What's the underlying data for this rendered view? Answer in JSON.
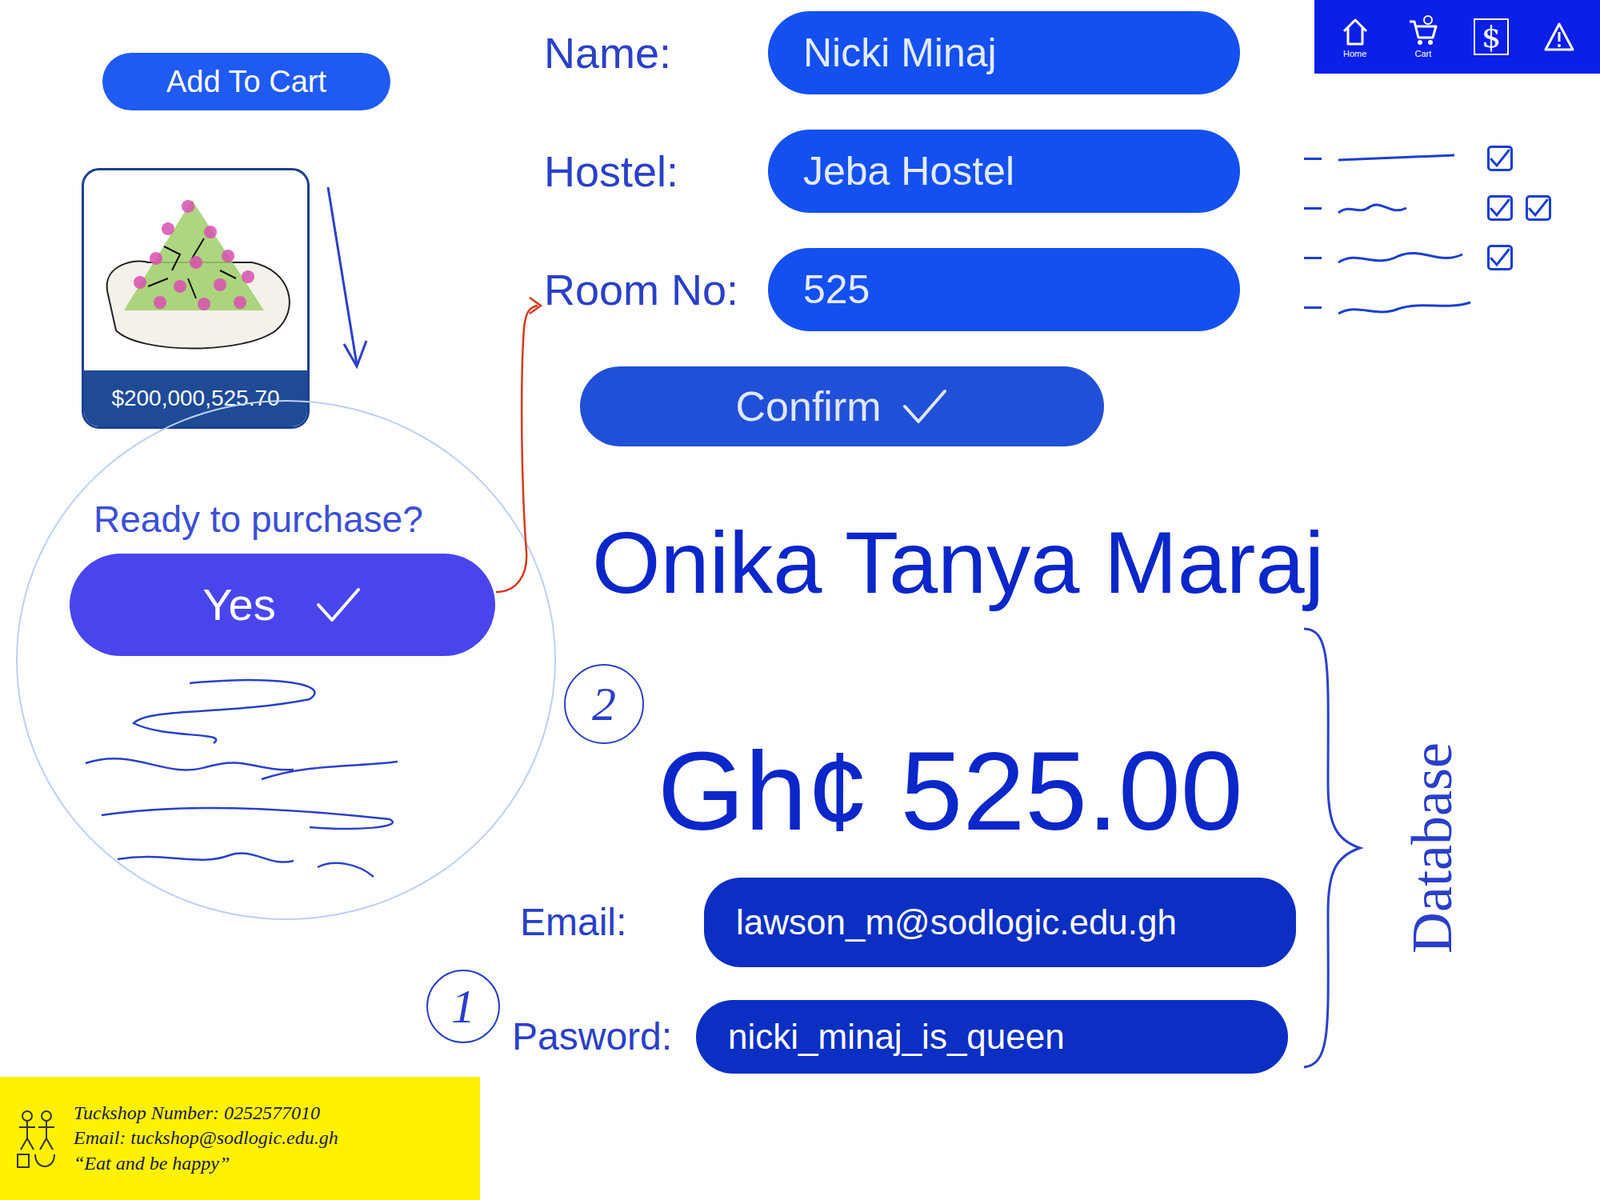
{
  "nav": {
    "items": [
      {
        "kind": "home",
        "label": "Home"
      },
      {
        "kind": "cart",
        "label": "Cart"
      },
      {
        "kind": "money",
        "glyph": "$"
      },
      {
        "kind": "alert"
      }
    ]
  },
  "add_to_cart": "Add To Cart",
  "product": {
    "price": "$200,000,525.70"
  },
  "form": {
    "fields": [
      {
        "label": "Name:",
        "value": "Nicki Minaj"
      },
      {
        "label": "Hostel:",
        "value": "Jeba Hostel"
      },
      {
        "label": "Room No:",
        "value": "525"
      }
    ],
    "confirm": "Confirm"
  },
  "checklist": [
    {
      "boxes": [
        true
      ]
    },
    {
      "boxes": [
        true,
        true
      ]
    },
    {
      "boxes": [
        true
      ]
    },
    {
      "boxes": []
    }
  ],
  "purchase": {
    "prompt": "Ready to purchase?",
    "yes": "Yes",
    "step": "2"
  },
  "account": {
    "name": "Onika Tanya Maraj",
    "amount": "Gh¢ 525.00",
    "step": "1",
    "fields": [
      {
        "label": "Email:",
        "value": "lawson_m@sodlogic.edu.gh"
      },
      {
        "label": "Pasword:",
        "value": "nicki_minaj_is_queen"
      }
    ],
    "bracket_label": "Database"
  },
  "footer": {
    "lines": [
      "Tuckshop Number: 0252577010",
      "Email: tuckshop@sodlogic.edu.gh",
      "“Eat and be happy”"
    ]
  }
}
